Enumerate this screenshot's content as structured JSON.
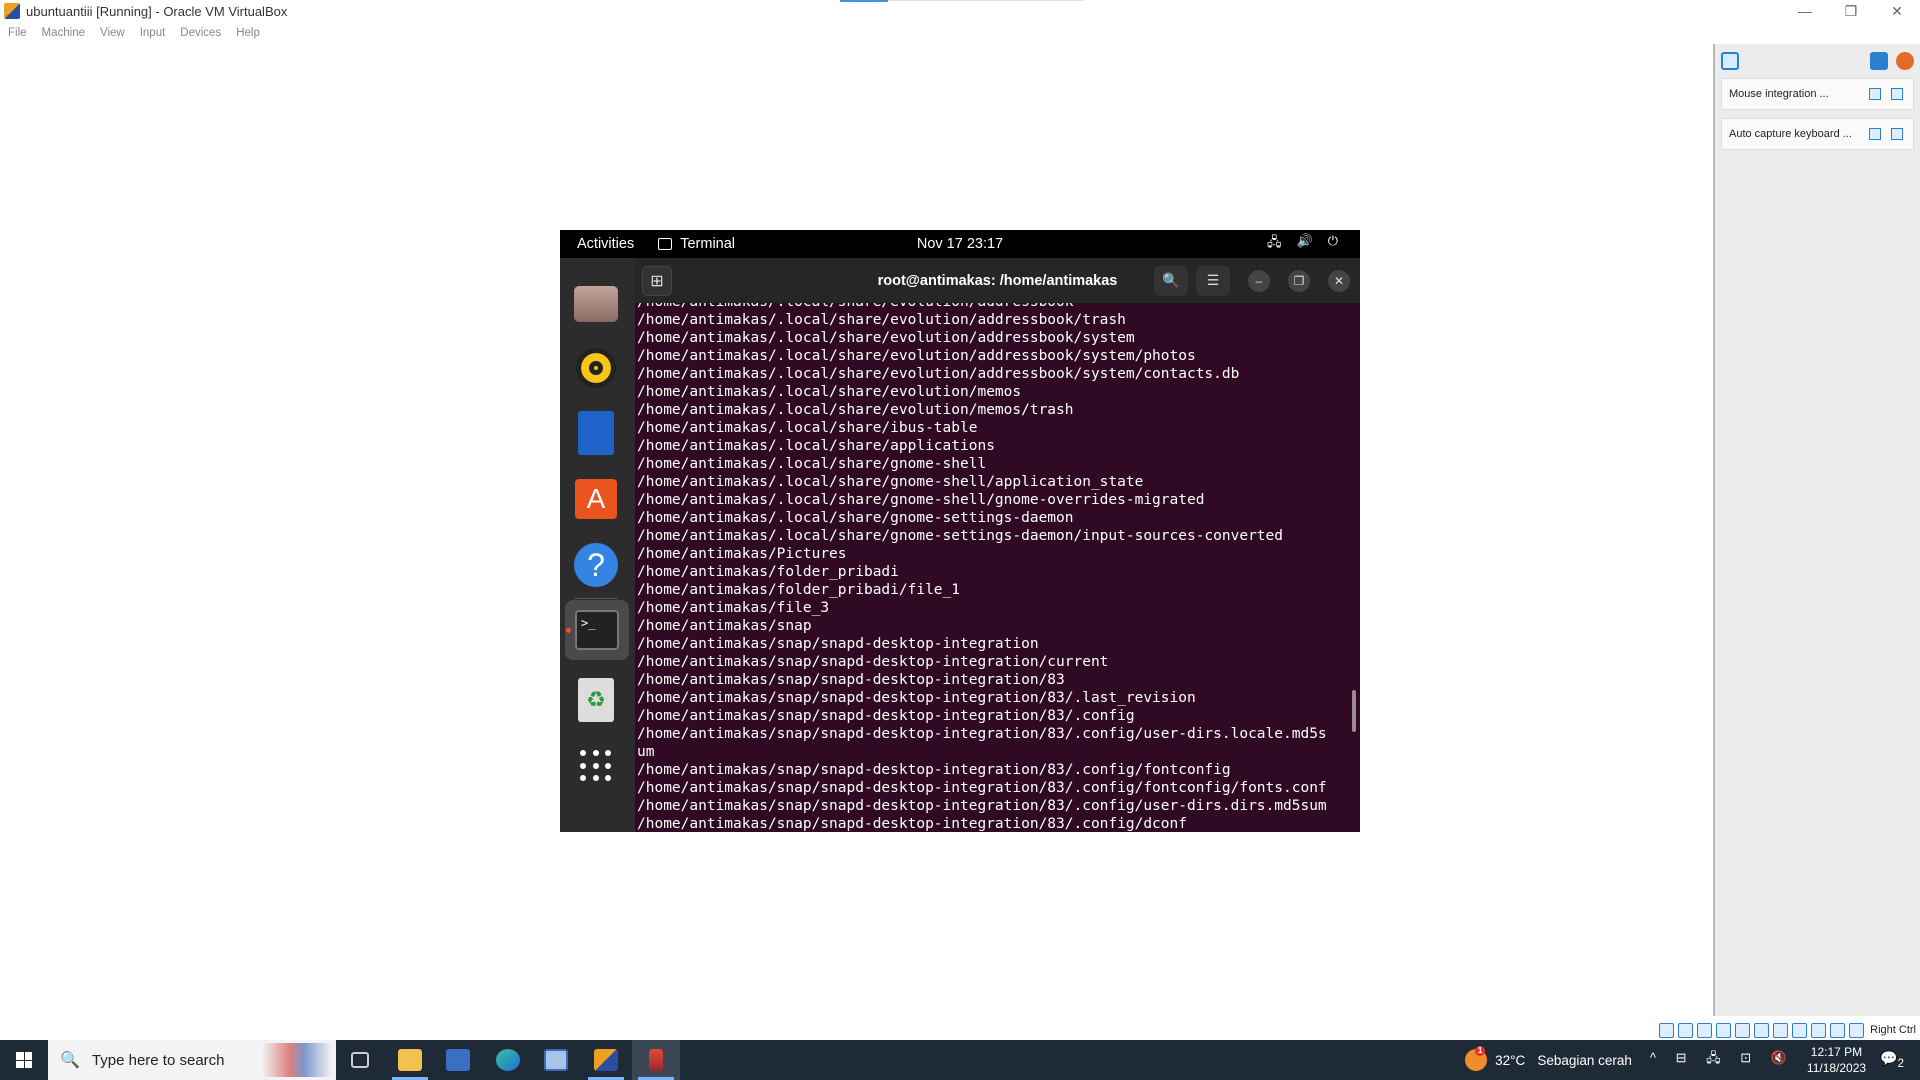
{
  "window": {
    "title": "ubuntuantiii [Running] - Oracle VM VirtualBox",
    "controls": {
      "minimize": "—",
      "restore": "❐",
      "close": "✕"
    }
  },
  "menubar": [
    "File",
    "Machine",
    "View",
    "Input",
    "Devices",
    "Help"
  ],
  "notifications": [
    {
      "text": "Mouse integration ..."
    },
    {
      "text": "Auto capture keyboard ..."
    }
  ],
  "gnome": {
    "activities": "Activities",
    "app": "Terminal",
    "clock": "Nov 17  23:17",
    "tray": [
      "🖧",
      "🔊",
      "⏻"
    ]
  },
  "dock": {
    "store_glyph": "A",
    "help_glyph": "?",
    "term_glyph": ">_",
    "trash_glyph": "♻"
  },
  "terminal": {
    "title": "root@antimakas: /home/antimakas",
    "newtab_glyph": "⊞",
    "search_glyph": "🔍",
    "menu_glyph": "☰",
    "min_glyph": "–",
    "max_glyph": "❐",
    "close_glyph": "✕",
    "partial_line": "/home/antimakas/.local/share/evolution/addressbook",
    "lines": [
      "/home/antimakas/.local/share/evolution/addressbook/trash",
      "/home/antimakas/.local/share/evolution/addressbook/system",
      "/home/antimakas/.local/share/evolution/addressbook/system/photos",
      "/home/antimakas/.local/share/evolution/addressbook/system/contacts.db",
      "/home/antimakas/.local/share/evolution/memos",
      "/home/antimakas/.local/share/evolution/memos/trash",
      "/home/antimakas/.local/share/ibus-table",
      "/home/antimakas/.local/share/applications",
      "/home/antimakas/.local/share/gnome-shell",
      "/home/antimakas/.local/share/gnome-shell/application_state",
      "/home/antimakas/.local/share/gnome-shell/gnome-overrides-migrated",
      "/home/antimakas/.local/share/gnome-settings-daemon",
      "/home/antimakas/.local/share/gnome-settings-daemon/input-sources-converted",
      "/home/antimakas/Pictures",
      "/home/antimakas/folder_pribadi",
      "/home/antimakas/folder_pribadi/file_1",
      "/home/antimakas/file_3",
      "/home/antimakas/snap",
      "/home/antimakas/snap/snapd-desktop-integration",
      "/home/antimakas/snap/snapd-desktop-integration/current",
      "/home/antimakas/snap/snapd-desktop-integration/83",
      "/home/antimakas/snap/snapd-desktop-integration/83/.last_revision",
      "/home/antimakas/snap/snapd-desktop-integration/83/.config",
      "/home/antimakas/snap/snapd-desktop-integration/83/.config/user-dirs.locale.md5s",
      "um",
      "/home/antimakas/snap/snapd-desktop-integration/83/.config/fontconfig",
      "/home/antimakas/snap/snapd-desktop-integration/83/.config/fontconfig/fonts.conf",
      "/home/antimakas/snap/snapd-desktop-integration/83/.config/user-dirs.dirs.md5sum",
      "/home/antimakas/snap/snapd-desktop-integration/83/.config/dconf"
    ]
  },
  "vbox_status": {
    "host_key": "Right Ctrl"
  },
  "taskbar": {
    "search_placeholder": "Type here to search",
    "search_glyph": "🔍",
    "weather_temp": "32°C",
    "weather_desc": "Sebagian cerah",
    "weather_badge": "1",
    "sys_icons": "^ ⊟ 🖧 ⊡ 🔇",
    "time": "12:17 PM",
    "date": "11/18/2023",
    "notify_glyph": "💬",
    "notify_count": "2"
  },
  "colors": {
    "terminal_bg": "#300a24",
    "dock_bg": "#2c2c2c",
    "taskbar_bg": "#1f2a37",
    "ubuntu_orange": "#e95420"
  }
}
